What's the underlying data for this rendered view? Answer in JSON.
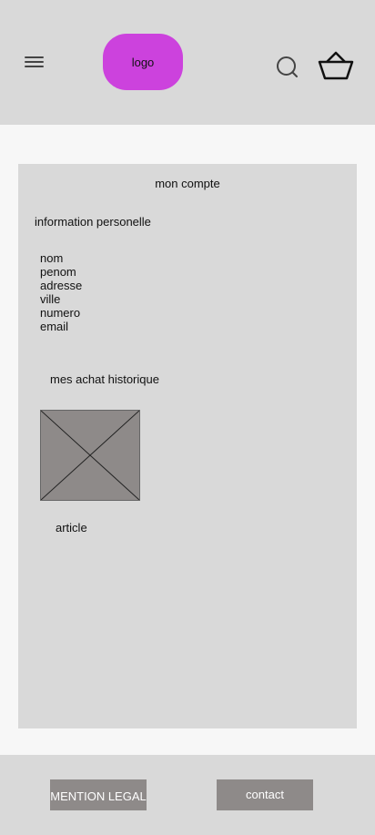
{
  "header": {
    "logo_label": "logo",
    "icons": {
      "menu": "hamburger-menu-icon",
      "search": "search-icon",
      "basket": "basket-icon"
    }
  },
  "account": {
    "title": "mon compte",
    "personal_section": {
      "heading": "information personelle",
      "fields": [
        "nom",
        "penom",
        "adresse",
        "ville",
        "numero",
        "email"
      ]
    },
    "history_section": {
      "heading": "mes achat historique",
      "items": [
        {
          "label": "article",
          "image": "placeholder-image"
        }
      ]
    }
  },
  "footer": {
    "legal_label": "MENTION LEGAL",
    "contact_label": "contact"
  },
  "colors": {
    "header_bg": "#d9d9d9",
    "page_bg": "#f7f7f7",
    "logo_bg": "#cc42dd",
    "button_bg": "#8e8a89",
    "placeholder_bg": "#8e8a89"
  }
}
